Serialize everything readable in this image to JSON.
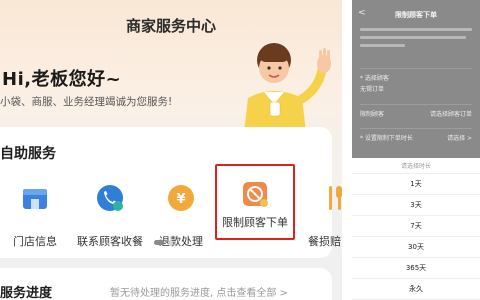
{
  "left": {
    "header_title": "商家服务中心",
    "greeting": "Hi,老板您好~",
    "greeting_sub": "小袋、商服、业务经理竭诚为您服务!",
    "self_service": {
      "title": "自助服务",
      "items": [
        {
          "label": "门店信息",
          "icon": "store-icon",
          "color": "#3b82e0"
        },
        {
          "label": "联系顾客收餐",
          "icon": "contact-customer-icon",
          "color": "#2f7fd8"
        },
        {
          "label": "退款处理",
          "icon": "refund-icon",
          "color": "#f2a93b"
        },
        {
          "label": "限制顾客下单",
          "icon": "restrict-order-icon",
          "color": "#f08a4b"
        },
        {
          "label": "餐损赔",
          "icon": "meal-loss-icon",
          "color": "#f2a93b"
        }
      ]
    },
    "progress": {
      "title": "服务进度",
      "text": "暂无待处理的服务进度, 点击查看全部 >"
    }
  },
  "right": {
    "back": "<",
    "title": "限制顾客下单",
    "field1": {
      "key": "* 选择顾客",
      "value": "无锡订单"
    },
    "field2": {
      "key": "限制顾客",
      "right": "请选择顾客订单"
    },
    "field3": {
      "key": "* 设置限制下单时长",
      "right": "请选择 >"
    },
    "sheet_title": "请选择时长",
    "options": [
      "1天",
      "3天",
      "7天",
      "30天",
      "365天",
      "永久"
    ]
  }
}
